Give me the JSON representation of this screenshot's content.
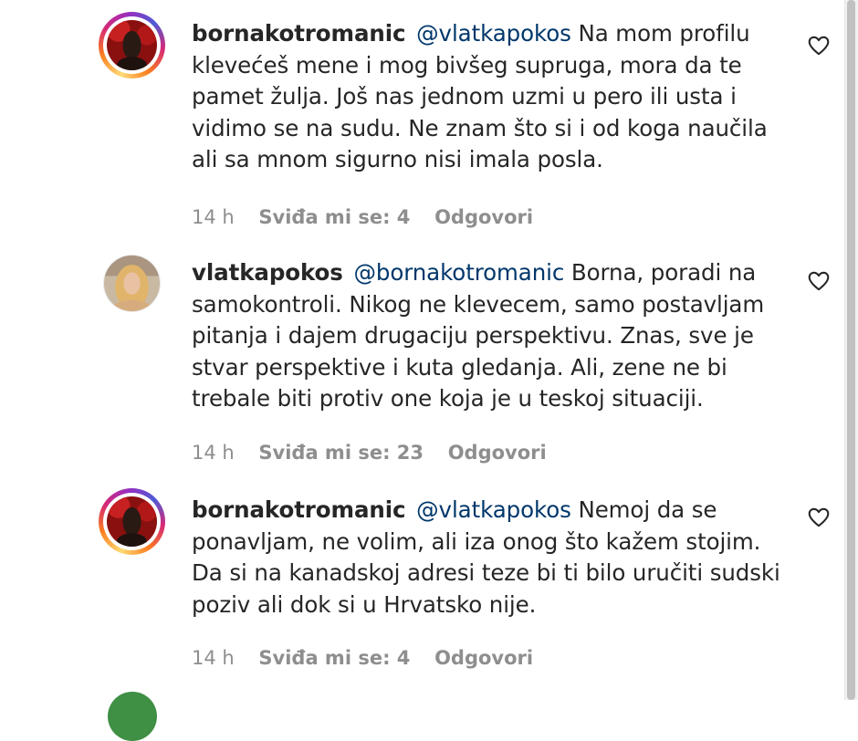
{
  "comments": [
    {
      "username": "bornakotromanic",
      "mention": "@vlatkapokos",
      "text": "Na mom profilu klevećeš mene i mog bivšeg supruga, mora da te pamet žulja. Još nas jednom uzmi u pero ili usta i vidimo se na sudu. Ne znam što si i od koga naučila ali sa mnom sigurno nisi imala posla.",
      "time": "14 h",
      "likes": "Sviđa mi se: 4",
      "reply": "Odgovori",
      "avatar": "story-ring"
    },
    {
      "username": "vlatkapokos",
      "mention": "@bornakotromanic",
      "text": "Borna, poradi na samokontroli. Nikog ne klevecem, samo postavljam pitanja i dajem drugaciju perspektivu. Znas, sve je stvar perspektive i kuta gledanja. Ali, zene ne bi trebale biti protiv one koja je u teskoj situaciji.",
      "time": "14 h",
      "likes": "Sviđa mi se: 23",
      "reply": "Odgovori",
      "avatar": "plain"
    },
    {
      "username": "bornakotromanic",
      "mention": "@vlatkapokos",
      "text": "Nemoj da se ponavljam, ne volim, ali iza onog što kažem stojim. Da si na kanadskoj adresi teze bi ti bilo uručiti sudski poziv ali dok si u Hrvatsko nije.",
      "time": "14 h",
      "likes": "Sviđa mi se: 4",
      "reply": "Odgovori",
      "avatar": "story-ring"
    }
  ],
  "icons": {
    "like": "heart-outline-icon"
  },
  "colors": {
    "text": "#262626",
    "mention": "#00376b",
    "meta": "#8e8e8e"
  }
}
